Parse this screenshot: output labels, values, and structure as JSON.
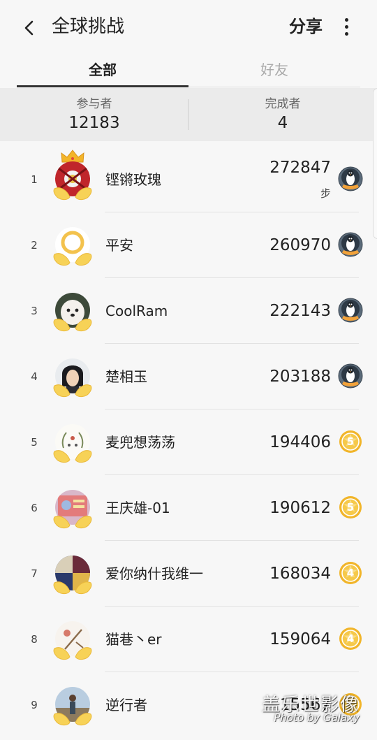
{
  "header": {
    "title": "全球挑战",
    "share_label": "分享"
  },
  "tabs": [
    {
      "label": "全部",
      "selected": true
    },
    {
      "label": "好友",
      "selected": false
    }
  ],
  "stats": {
    "participants_label": "参与者",
    "participants_value": "12183",
    "finishers_label": "完成者",
    "finishers_value": "4"
  },
  "colors": {
    "accent": "#333333",
    "gold_badge": "#f1b52a",
    "wing_yellow": "#f7d257"
  },
  "ranking": [
    {
      "rank": "1",
      "name": "铿锵玫瑰",
      "steps": "272847",
      "unit": "步",
      "badge": "penguin-badge-icon",
      "crown": true
    },
    {
      "rank": "2",
      "name": "平安",
      "steps": "260970",
      "badge": "penguin-badge-icon"
    },
    {
      "rank": "3",
      "name": "CoolRam",
      "steps": "222143",
      "badge": "penguin-badge-icon"
    },
    {
      "rank": "4",
      "name": "楚相玉",
      "steps": "203188",
      "badge": "penguin-badge-icon"
    },
    {
      "rank": "5",
      "name": "麦兜想荡荡",
      "steps": "194406",
      "badge": "gold-5-badge-icon",
      "badge_number": "5"
    },
    {
      "rank": "6",
      "name": "王庆雄-01",
      "steps": "190612",
      "badge": "gold-5-badge-icon",
      "badge_number": "5"
    },
    {
      "rank": "7",
      "name": "爱你纳什我维一",
      "steps": "168034",
      "badge": "gold-4-badge-icon",
      "badge_number": "4"
    },
    {
      "rank": "8",
      "name": "猫巷丶er",
      "steps": "159064",
      "badge": "gold-4-badge-icon",
      "badge_number": "4"
    },
    {
      "rank": "9",
      "name": "逆行者",
      "steps": "15567",
      "badge": "gold-badge-icon"
    }
  ],
  "watermark": {
    "title": "盖乐世影像",
    "subtitle": "Photo by Galaxy"
  }
}
